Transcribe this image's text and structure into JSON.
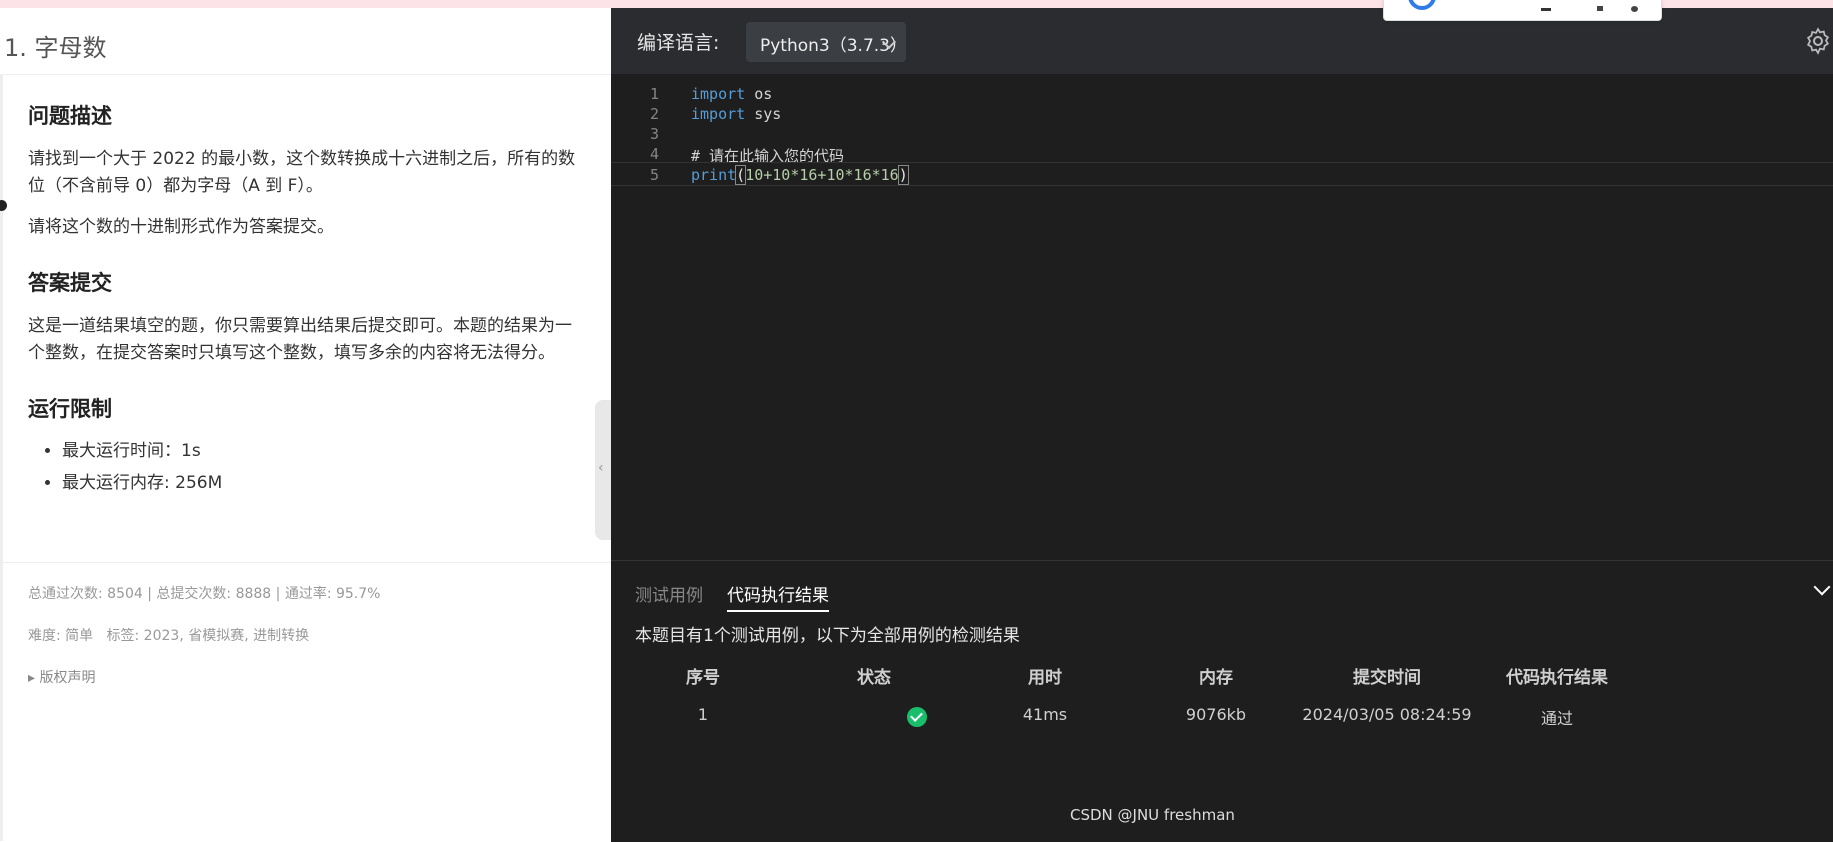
{
  "problem": {
    "title": "1. 字母数",
    "sections": {
      "desc_heading": "问题描述",
      "desc_p1": "请找到一个大于 2022 的最小数，这个数转换成十六进制之后，所有的数位（不含前导 0）都为字母（A 到 F）。",
      "desc_p2": "请将这个数的十进制形式作为答案提交。",
      "submit_heading": "答案提交",
      "submit_p": "这是一道结果填空的题，你只需要算出结果后提交即可。本题的结果为一个整数，在提交答案时只填写这个整数，填写多余的内容将无法得分。",
      "limit_heading": "运行限制",
      "limits": [
        "最大运行时间：1s",
        "最大运行内存: 256M"
      ]
    },
    "stats": "总通过次数: 8504 | 总提交次数: 8888 | 通过率: 95.7%",
    "meta": "难度: 简单   标签: 2023, 省模拟赛, 进制转换",
    "copyright": "▸ 版权声明"
  },
  "editor": {
    "lang_label": "编译语言:",
    "lang_value": "Python3（3.7.3）",
    "line_numbers": [
      "1",
      "2",
      "3",
      "4",
      "5"
    ],
    "lines": [
      "import os",
      "import sys",
      "",
      "# 请在此输入您的代码",
      "print(10+10*16+10*16*16)"
    ],
    "tokens": {
      "import": "import",
      "os": " os",
      "sys": " sys",
      "comment": "# 请在此输入您的代码",
      "print": "print",
      "open": "(",
      "expr": "10+10*16+10*16*16",
      "close": ")"
    }
  },
  "results": {
    "tabs": [
      "测试用例",
      "代码执行结果"
    ],
    "summary": "本题目有1个测试用例，以下为全部用例的检测结果",
    "columns": [
      "序号",
      "状态",
      "用时",
      "内存",
      "提交时间",
      "代码执行结果"
    ],
    "row": {
      "index": "1",
      "status_icon": "check-circle-icon",
      "time": "41ms",
      "memory": "9076kb",
      "submitted": "2024/03/05 08:24:59",
      "result": "通过"
    }
  },
  "watermark": "CSDN @JNU freshman",
  "colors": {
    "accent_ok": "#19be6b",
    "editor_bg": "#1e1e1e",
    "keyword": "#569cd6",
    "comment": "#6a9955"
  }
}
